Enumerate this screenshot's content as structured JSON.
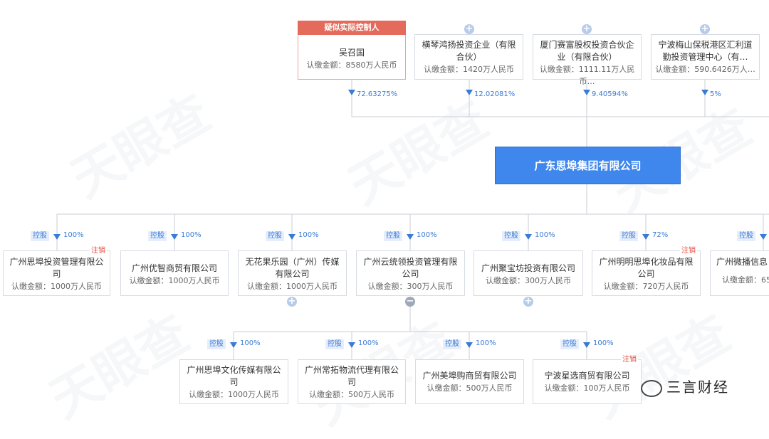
{
  "watermark": "天眼查",
  "controller_tag": "疑似实际控制人",
  "center_company": "广东思埠集团有限公司",
  "shareholders": [
    {
      "name": "吴召国",
      "amount": "认缴金额：8580万人民币",
      "pct": "72.63275%"
    },
    {
      "name": "横琴鸿扬投资企业（有限合伙）",
      "amount": "认缴金额：1420万人民币",
      "pct": "12.02081%"
    },
    {
      "name": "厦门赛富股权投资合伙企业（有限合伙）",
      "amount": "认缴金额：1111.11万人民币…",
      "pct": "9.40594%"
    },
    {
      "name": "宁波梅山保税港区汇利道勤投资管理中心（有…",
      "amount": "认缴金额：590.6426万人…",
      "pct": "5%"
    }
  ],
  "control_label": "控股",
  "cancelled_label": "注销",
  "subsidiaries": [
    {
      "name": "广州思埠投资管理有限公司",
      "amount": "认缴金额：1000万人民币",
      "pct": "100%",
      "cancelled": true
    },
    {
      "name": "广州优智商贸有限公司",
      "amount": "认缴金额：1000万人民币",
      "pct": "100%"
    },
    {
      "name": "无花果乐园（广州）传媒有限公司",
      "amount": "认缴金额：1000万人民币",
      "pct": "100%"
    },
    {
      "name": "广州云统领投资管理有限公司",
      "amount": "认缴金额：300万人民币",
      "pct": "100%"
    },
    {
      "name": "广州聚宝坊投资有限公司",
      "amount": "认缴金额：300万人民币",
      "pct": "100%"
    },
    {
      "name": "广州明明思埠化妆品有限公司",
      "amount": "认缴金额：720万人民币",
      "pct": "72%",
      "cancelled": true
    },
    {
      "name": "广州微播信息",
      "amount": "认缴金额：65",
      "pct": ""
    }
  ],
  "sub_subsidiaries": [
    {
      "name": "广州思埠文化传媒有限公司",
      "amount": "认缴金额：1000万人民币",
      "pct": "100%"
    },
    {
      "name": "广州常拓物流代理有限公司",
      "amount": "认缴金额：500万人民币",
      "pct": "100%"
    },
    {
      "name": "广州美埠购商贸有限公司",
      "amount": "认缴金额：500万人民币",
      "pct": "100%"
    },
    {
      "name": "宁波星选商贸有限公司",
      "amount": "认缴金额：100万人民币",
      "pct": "100%",
      "cancelled": true
    }
  ],
  "brand": "三言财经"
}
